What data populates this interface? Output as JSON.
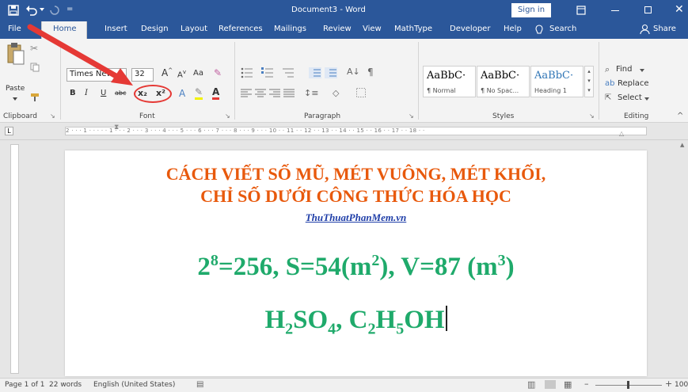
{
  "titlebar": {
    "title": "Document3 - Word",
    "sign_in": "Sign in"
  },
  "menu": {
    "tabs": [
      "File",
      "Home",
      "Insert",
      "Design",
      "Layout",
      "References",
      "Mailings",
      "Review",
      "View",
      "MathType",
      "Developer",
      "Help"
    ],
    "search": "Search",
    "share": "Share"
  },
  "ribbon": {
    "clipboard": {
      "paste": "Paste",
      "label": "Clipboard"
    },
    "font": {
      "font_name": "Times New",
      "font_size": "32",
      "change_case": "Aa",
      "bold": "B",
      "italic": "I",
      "underline": "U",
      "strike": "abc",
      "subscript": "x₂",
      "superscript": "x²",
      "label": "Font"
    },
    "paragraph": {
      "label": "Paragraph"
    },
    "styles": {
      "items": [
        {
          "preview": "AaBbC·",
          "name": "¶ Normal"
        },
        {
          "preview": "AaBbC·",
          "name": "¶ No Spac..."
        },
        {
          "preview": "AaBbC·",
          "name": "Heading 1"
        }
      ],
      "label": "Styles"
    },
    "editing": {
      "find": "Find",
      "replace": "Replace",
      "select": "Select",
      "label": "Editing"
    }
  },
  "document": {
    "title_line1": "CÁCH VIẾT SỐ MŨ, MÉT VUÔNG, MÉT KHỐI,",
    "title_line2": "CHỈ SỐ DƯỚI CÔNG THỨC HÓA HỌC",
    "link": "ThuThuatPhanMem.vn",
    "eq": {
      "base1": "2",
      "exp1": "8",
      "part1": "=256, S=54(m",
      "exp2": "2",
      "part2": "),  V=87 (m",
      "exp3": "3",
      "part3": ")"
    },
    "chem": {
      "a": "H",
      "a_sub": "2",
      "b": "SO",
      "b_sub": "4",
      "c": ", C",
      "c_sub": "2",
      "d": "H",
      "d_sub": "5",
      "e": "OH"
    }
  },
  "status": {
    "page": "Page 1 of 1",
    "words": "22 words",
    "language": "English (United States)",
    "zoom": "100%"
  },
  "ruler_text": "2 · · · 1 · · · · · 1 · · · 2 · · · 3 · · · 4 · · · 5 · · · 6 · · · 7 · · · 8 · · · 9 · · · 10 · · 11 · · 12 · · 13 · · 14 · · 15 · · 16 · · 17 · · 18 · ·",
  "colors": {
    "word_blue": "#2b579a",
    "title_orange": "#e8590c",
    "link_blue": "#1f3ea8",
    "formula_green": "#1faa6b",
    "arrow_red": "#e53935"
  }
}
